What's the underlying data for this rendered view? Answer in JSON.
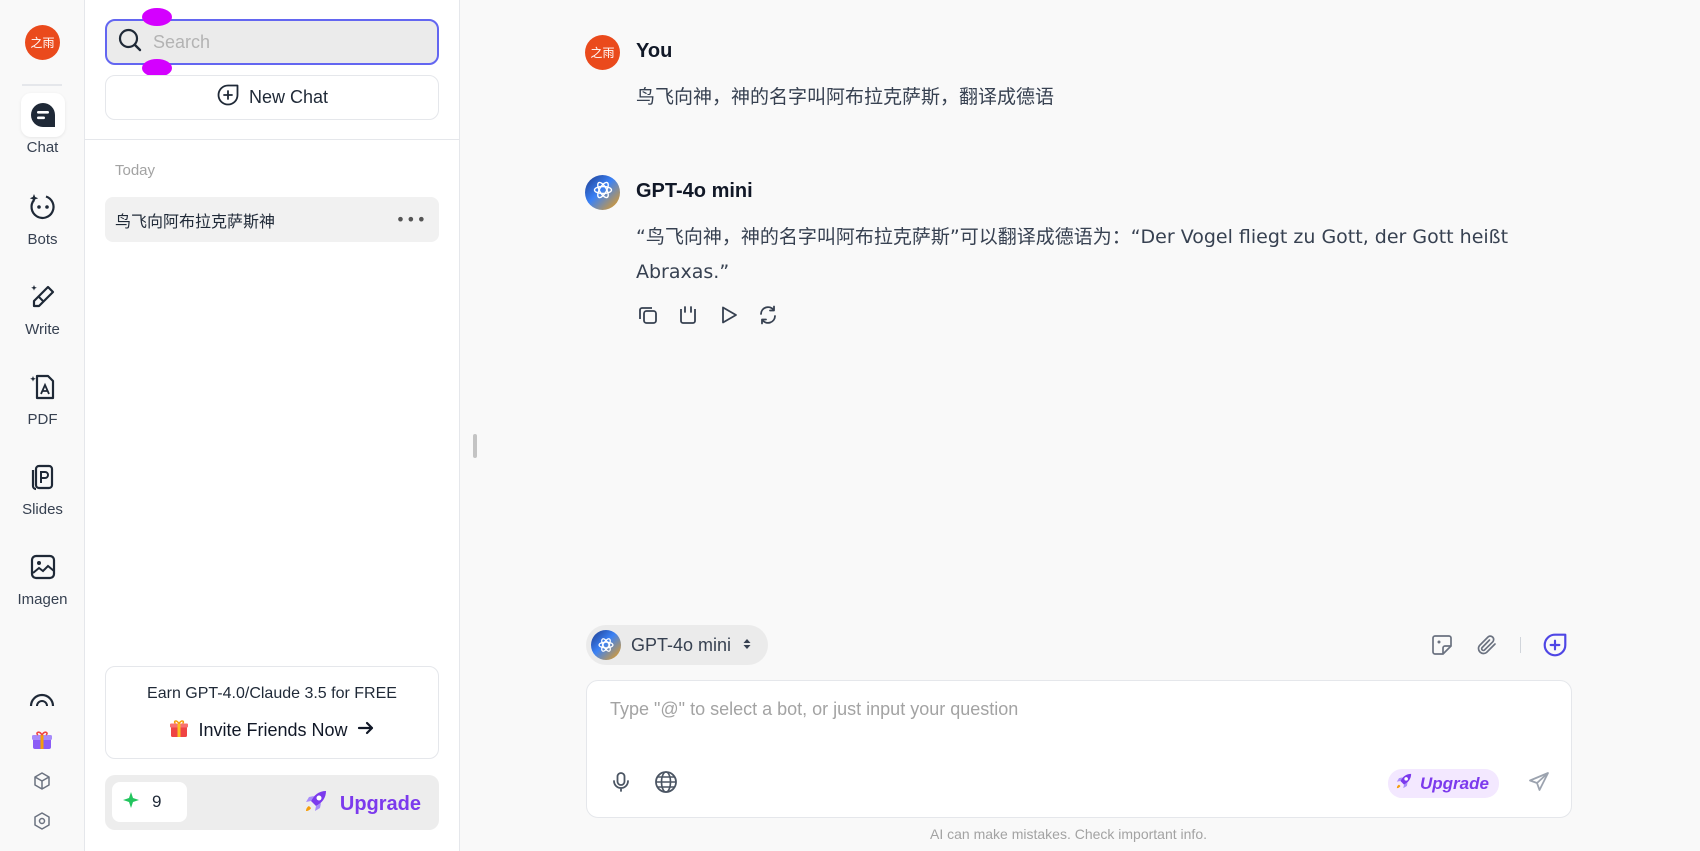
{
  "rail": {
    "avatar_text": "之雨",
    "items": [
      {
        "label": "Chat",
        "icon": "chat-icon"
      },
      {
        "label": "Bots",
        "icon": "bots-icon"
      },
      {
        "label": "Write",
        "icon": "write-icon"
      },
      {
        "label": "PDF",
        "icon": "pdf-icon"
      },
      {
        "label": "Slides",
        "icon": "slides-icon"
      },
      {
        "label": "Imagen",
        "icon": "imagen-icon"
      }
    ],
    "bottom_icons": [
      "gift-icon",
      "cube-icon",
      "settings-icon"
    ]
  },
  "panel": {
    "search_placeholder": "Search",
    "search_value": "",
    "new_chat_label": "New Chat",
    "section_today": "Today",
    "chats": [
      {
        "title": "鸟飞向阿布拉克萨斯神"
      }
    ],
    "promo_title": "Earn GPT-4.0/Claude 3.5 for FREE",
    "promo_link": "Invite Friends Now",
    "credits": "9",
    "upgrade_label": "Upgrade"
  },
  "conversation": {
    "messages": [
      {
        "sender": "You",
        "text": "鸟飞向神，神的名字叫阿布拉克萨斯，翻译成德语"
      },
      {
        "sender": "GPT-4o mini",
        "text": "“鸟飞向神，神的名字叫阿布拉克萨斯”可以翻译成德语为：“Der Vogel fliegt zu Gott, der Gott heißt Abraxas.”"
      }
    ],
    "actions": [
      "copy-icon",
      "quote-icon",
      "play-icon",
      "regenerate-icon"
    ]
  },
  "composer": {
    "model": "GPT-4o mini",
    "placeholder": "Type \"@\" to select a bot, or just input your question",
    "upgrade_label": "Upgrade",
    "disclaimer": "AI can make mistakes. Check important info."
  },
  "colors": {
    "accent": "#6366f1",
    "brand": "#ea4a1c",
    "upgrade": "#7c3aed"
  }
}
